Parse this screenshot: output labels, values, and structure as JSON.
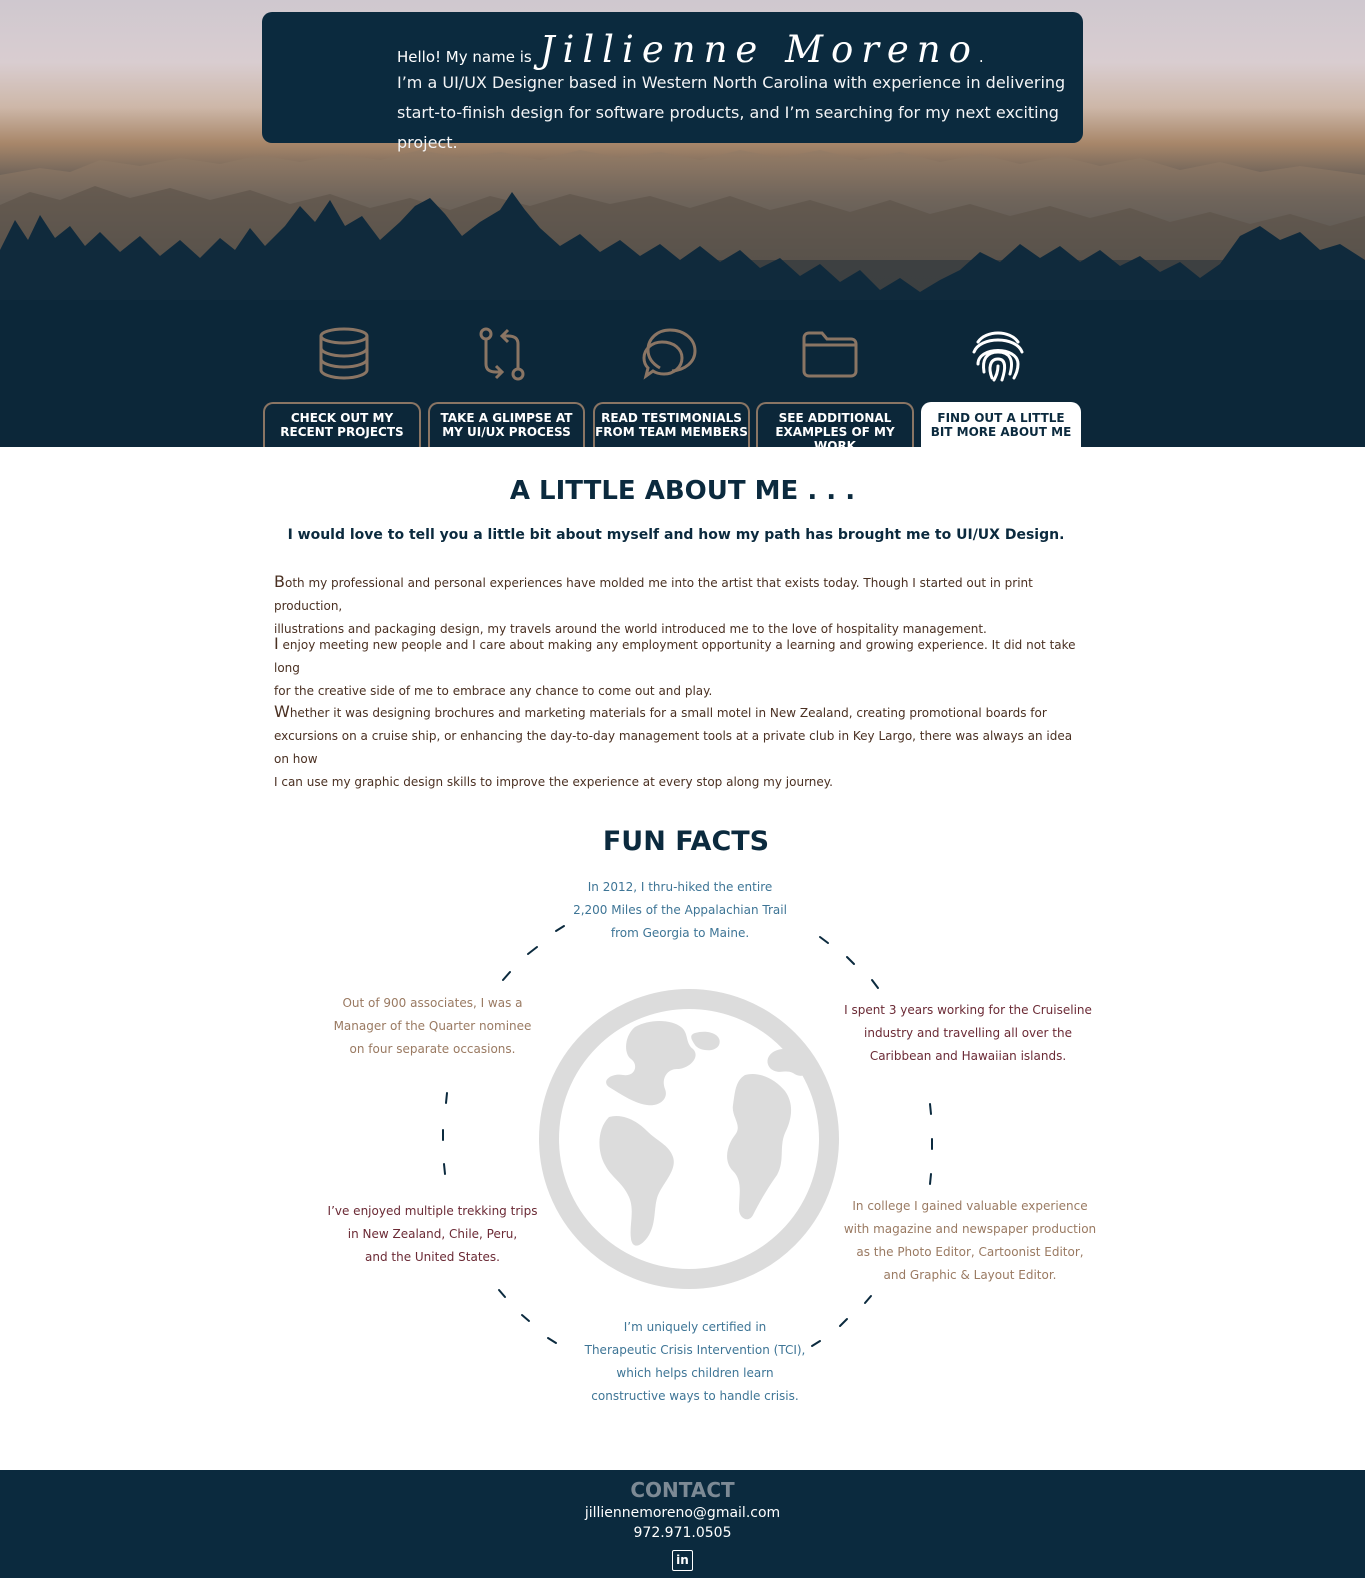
{
  "intro": {
    "hello": "Hello!  My name is",
    "name": "Jillienne Moreno",
    "name_dot": ".",
    "line1": "I’m a UI/UX Designer based in Western North Carolina with experience in delivering",
    "line2": "start-to-finish design for software products, and I’m searching for my next exciting project."
  },
  "nav": {
    "icons": [
      "database-icon",
      "pull-request-icon",
      "chat-bubbles-icon",
      "folder-icon",
      "fingerprint-icon"
    ],
    "tabs": [
      {
        "line1": "CHECK OUT MY",
        "line2": "RECENT PROJECTS"
      },
      {
        "line1": "TAKE A GLIMPSE AT",
        "line2": "MY UI/UX PROCESS"
      },
      {
        "line1": "READ TESTIMONIALS",
        "line2": "FROM TEAM MEMBERS"
      },
      {
        "line1": "SEE ADDITIONAL",
        "line2": "EXAMPLES OF MY WORK"
      },
      {
        "line1": "FIND OUT A LITTLE",
        "line2": "BIT MORE  ABOUT ME"
      }
    ],
    "active_tab": 4
  },
  "about": {
    "title": "A LITTLE ABOUT ME . . .",
    "subtitle": "I would love to tell you a little bit about myself and how my path has brought me to UI/UX Design.",
    "p1_cap": "B",
    "p1_l1": "oth my professional and personal experiences have molded me into the artist that exists today. Though I started out in print production,",
    "p1_l2": "illustrations and packaging design, my travels around the world introduced me to the love of hospitality management.",
    "p2_cap": "I",
    "p2_l1": " enjoy meeting new people and I care about making any employment opportunity a learning and growing experience. It did not take long",
    "p2_l2": "for the creative side of me to embrace any chance to come out and play.",
    "p3_cap": "W",
    "p3_l1": "hether it was designing brochures and marketing materials for a small motel in New Zealand, creating promotional boards for",
    "p3_l2": "excursions on a cruise ship, or enhancing the day-to-day management tools at a private club in Key Largo, there was always an idea on how",
    "p3_l3": "I can use my graphic design skills to improve the experience at every stop along my journey."
  },
  "fun_facts": {
    "title": "FUN FACTS",
    "colors": {
      "blue": "#3e7596",
      "tan": "#9a7a62",
      "maroon": "#6b2a35",
      "globe": "#dcdcdc"
    },
    "top": [
      "In 2012, I thru-hiked the entire",
      "2,200 Miles of the Appalachian Trail",
      "from Georgia to Maine."
    ],
    "upper_right": [
      "I spent 3 years working for the Cruiseline",
      "industry and travelling all over the",
      "Caribbean and Hawaiian islands."
    ],
    "lower_right": [
      "In college I gained valuable  experience",
      "with magazine and newspaper production",
      "as the Photo Editor, Cartoonist Editor,",
      "and Graphic & Layout Editor."
    ],
    "bottom": [
      "I’m uniquely certified in",
      "Therapeutic Crisis Intervention (TCI),",
      "which helps children learn",
      "constructive ways to handle crisis."
    ],
    "lower_left": [
      "I’ve enjoyed multiple trekking trips",
      "in New Zealand, Chile, Peru,",
      "and the United States."
    ],
    "upper_left": [
      "Out of 900 associates, I was a",
      "Manager of the Quarter nominee",
      "on four separate occasions."
    ]
  },
  "contact": {
    "title": "CONTACT",
    "email": "jilliennemoreno@gmail.com",
    "phone": "972.971.0505",
    "linkedin": "in"
  }
}
